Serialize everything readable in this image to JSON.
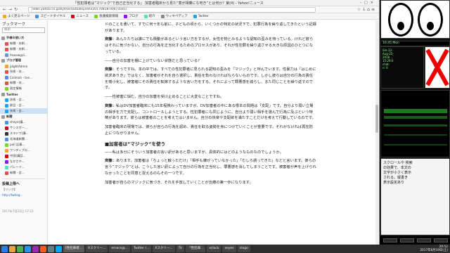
{
  "browser": {
    "title": "「性犯罪者は”マジック”で自己正当化する」 加害者臨床から見た”寛が相乗にな吧き”とは何か？第(4) - Yahoo!ニュース",
    "url": "news.yahoo.co.jp/byline/saitoakiyoshi/20170818-00073541/"
  },
  "bookmarks_toolbar": [
    {
      "label": "よく見るページ",
      "color": "#f5a623"
    },
    {
      "label": "スピードダイヤル",
      "color": "#4a90e2"
    },
    {
      "label": "ニュース",
      "color": "#d0021b"
    },
    {
      "label": "会議検索情報",
      "color": "#7ed321"
    },
    {
      "label": "ブログ",
      "color": "#9013fe"
    },
    {
      "label": "紹介",
      "color": "#50e3c2"
    },
    {
      "label": "ウィキペディア",
      "color": "#888888"
    },
    {
      "label": "Twitter",
      "color": "#1da1f2"
    }
  ],
  "sidebar": {
    "header": "ブックマーク",
    "search_placeholder": "検索",
    "rows": [
      {
        "label": "手帳の使い方",
        "color": "#999",
        "type": "folder"
      },
      {
        "label": "新聞 - 技術...",
        "color": "#e94e4e",
        "type": "item"
      },
      {
        "label": "新聞 - 技術...",
        "color": "#e94e4e",
        "type": "item"
      },
      {
        "label": "freeew@li...",
        "color": "#5b9bd5",
        "type": "item"
      },
      {
        "label": "ブログ管理",
        "color": "#999",
        "type": "folder"
      },
      {
        "label": "plightAdmin",
        "color": "#f5a623",
        "type": "item"
      },
      {
        "label": "技術 - 技...",
        "color": "#e94e4e",
        "type": "item"
      },
      {
        "label": "Calimah - tve...",
        "color": "#4a90e2",
        "type": "item"
      },
      {
        "label": "新聞 - 技...",
        "color": "#e94e4e",
        "type": "item"
      },
      {
        "label": "固定情報",
        "color": "#7ed321",
        "type": "item"
      },
      {
        "label": "Twitter",
        "color": "#999",
        "type": "folder"
      },
      {
        "label": "技術 - 会...",
        "color": "#1da1f2",
        "type": "item"
      },
      {
        "label": "総会 - 会...",
        "color": "#1da1f2",
        "type": "item"
      },
      {
        "label": "技術 - 会...",
        "color": "#1da1f2",
        "type": "item"
      },
      {
        "label": "新聞",
        "color": "#999",
        "type": "folder"
      },
      {
        "label": "shoyo(講...",
        "color": "#4a90e2",
        "type": "item"
      },
      {
        "label": "サンスポー...",
        "color": "#d0021b",
        "type": "item"
      },
      {
        "label": "スラドで(講...",
        "color": "#333333",
        "type": "item"
      },
      {
        "label": "北海道新聞...",
        "color": "#4a90e2",
        "type": "item"
      },
      {
        "label": "pull 記事...",
        "color": "#7ed321",
        "type": "item"
      },
      {
        "label": "ワンディブロ...",
        "color": "#f5a623",
        "type": "item"
      },
      {
        "label": "中国(講話...",
        "color": "#d0021b",
        "type": "item"
      },
      {
        "label": "ながさや...",
        "color": "#9013fe",
        "type": "item"
      },
      {
        "label": "パレード...",
        "color": "#50e3c2",
        "type": "item"
      },
      {
        "label": "新聞 - 会...",
        "color": "#e94e4e",
        "type": "item"
      }
    ],
    "twitter": {
      "title": "投稿上限へ",
      "line": "【リンク】",
      "link": "http://twilog...",
      "time": "2017年7月22日 17:22"
    }
  },
  "article": {
    "paragraphs": [
      {
        "speaker": "",
        "text": "ドのことを書いて、すでに何十年も前に、子どもの頃から、いくつかの特定の状況下で、犯罪行為を繰り返してきたという記録があります。"
      },
      {
        "speaker": "斉藤：",
        "text": "あんたたちは誰にでも衝動があるという言い方をするが、女性を物とみるような認知の歪みを持っている。けれど彼らはそれに気づかない。自分の行為を正当化するためのプロセスがあり、それが性犯罪を繰り返させる大きな原因のひとつになっている。"
      },
      {
        "speaker": "",
        "text": "——自分の加害を棚に上げていない状態だと思っている？"
      },
      {
        "speaker": "斉藤：",
        "text": "そうですね。本の中では、すべての性犯罪者に見られる認知の歪みを「マジック」と呼んでいます。性暴力は「はじめに欲求ありき」ではなく、加害者がそれを自ら選択し、責任を負わなければならないものです。しかし彼らは自分の行為の責任を矮小化し、被害者にその責任を転嫁するような言い方をする。それによって罪悪感を減らし、また同じことを繰り返すのです。"
      },
      {
        "speaker": "",
        "text": "——性被害に悩む、自分の加害を受け止めることに大変なことですね。"
      },
      {
        "speaker": "斉藤：",
        "text": "私はDV加害者臨床にも15年程携わっていますが、DV加害者の中にある根本の問題は「支配」です。自分より弱い立場の相手を力で支配し、コントロールしようとする。性犯罪者にも同じように、自分より弱い相手を選んで行為に及ぶという特徴があります。彼らは被害者のことを考えてはいません。自分の快楽や支配欲を満たすことだけを考えて行動しているのです。"
      },
      {
        "speaker": "",
        "text": "加害者臨床の現場では、彼らが自らの行為を認め、責任を取る姿勢を身につけていくことが重要です。それがなければ再犯防止につながりません。"
      }
    ],
    "heading": "■加害者は”マジック”を使う",
    "paragraphs2": [
      {
        "speaker": "",
        "text": "——私は多分にそういう加害者の言い訳があると思いますが、具体的にはどのようなものなのでしょうか。"
      },
      {
        "speaker": "斉藤：",
        "text": "あります。加害者は「ちょっと触っただけ」「相手も嫌がっていなかった」「むしろ誘ってきた」などと言います。彼らの言う”マジック”とは、こうした言い訳によって自分の行為を正当化し、罪悪感を消してしまうことです。被害者が声を上げられなかったことを同意と捉えるのもその一つです。"
      },
      {
        "speaker": "",
        "text": "加害者が自らのマジックに気づき、それを手放していくことが治療の第一歩になります。"
      }
    ]
  },
  "right": {
    "clock_text": "16:45 Mon",
    "cells_lines": [
      "Sm-13-",
      "Aug-25-",
      "2018 ...",
      "15:29:0",
      "chat:",
      "n: 0"
    ],
    "note_lines": [
      "スクロールや 検索",
      "の効果で、本文の",
      "文字が小さく表示",
      "される。縦書き",
      "表示設定あり"
    ]
  },
  "taskbar": {
    "tasks": [
      {
        "label": "[性犯罪者...",
        "active": true
      },
      {
        "label": "Xスクリー...",
        "active": false
      },
      {
        "label": "emacs@...",
        "active": false
      },
      {
        "label": "Twitter /...",
        "active": false
      },
      {
        "label": "Xスクリー...",
        "active": false
      },
      {
        "label": "Tk",
        "active": false
      },
      {
        "label": "「性犯罪...",
        "active": false
      },
      {
        "label": "xclock",
        "active": false
      },
      {
        "label": "xeyes",
        "active": false
      },
      {
        "label": "xlogo",
        "active": false
      }
    ],
    "clock_time": "20:52",
    "clock_date": "2017年8月19日(土)"
  }
}
